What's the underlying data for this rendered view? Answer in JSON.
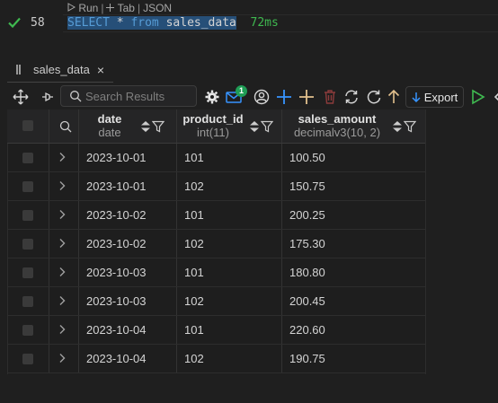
{
  "codelens": {
    "run": "Run",
    "sep1": "|",
    "tab": "Tab",
    "sep2": "|",
    "json": "JSON"
  },
  "editor": {
    "line_number": "58",
    "keyword_select": "SELECT",
    "star": " * ",
    "keyword_from": "from",
    "table": " sales_data",
    "timing": "72ms"
  },
  "results_tab": {
    "label": "sales_data",
    "close": "×"
  },
  "toolbar": {
    "search_placeholder": "Search Results",
    "notification_count": "1",
    "export_label": "Export"
  },
  "grid": {
    "columns": [
      {
        "name": "date",
        "type": "date"
      },
      {
        "name": "product_id",
        "type": "int(11)"
      },
      {
        "name": "sales_amount",
        "type": "decimalv3(10, 2)"
      }
    ],
    "rows": [
      [
        "2023-10-01",
        "101",
        "100.50"
      ],
      [
        "2023-10-01",
        "102",
        "150.75"
      ],
      [
        "2023-10-02",
        "101",
        "200.25"
      ],
      [
        "2023-10-02",
        "102",
        "175.30"
      ],
      [
        "2023-10-03",
        "101",
        "180.80"
      ],
      [
        "2023-10-03",
        "102",
        "200.45"
      ],
      [
        "2023-10-04",
        "101",
        "220.60"
      ],
      [
        "2023-10-04",
        "102",
        "190.75"
      ]
    ]
  },
  "colors": {
    "accent_blue": "#3794ff",
    "success_green": "#3fb950",
    "add_column_yellow": "#e2c08d",
    "delete_red": "#8c3b3b"
  }
}
